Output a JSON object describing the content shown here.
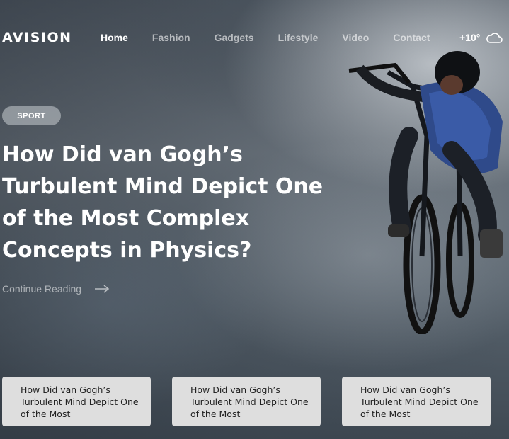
{
  "nav": {
    "logo": "AVISION",
    "items": [
      {
        "label": "Home",
        "active": true
      },
      {
        "label": "Fashion",
        "active": false
      },
      {
        "label": "Gadgets",
        "active": false
      },
      {
        "label": "Lifestyle",
        "active": false
      },
      {
        "label": "Video",
        "active": false
      },
      {
        "label": "Contact",
        "active": false
      }
    ],
    "weather": {
      "temperature": "+10°",
      "icon": "cloud-icon"
    }
  },
  "hero": {
    "category": "SPORT",
    "title": "How Did van Gogh’s Turbulent Mind Depict One of the Most Complex Concepts in Physics?",
    "cta": "Continue Reading",
    "cta_icon": "arrow-right-icon",
    "image": "bmx-rider-photo"
  },
  "cards": [
    {
      "title": "How Did van Gogh’s Turbulent Mind Depict One of the Most"
    },
    {
      "title": "How Did van Gogh’s Turbulent Mind Depict One of the Most"
    },
    {
      "title": "How Did van Gogh’s Turbulent Mind Depict One of the Most"
    }
  ],
  "colors": {
    "text": "#ffffff",
    "card_bg": "#dedede",
    "card_text": "#222222"
  }
}
